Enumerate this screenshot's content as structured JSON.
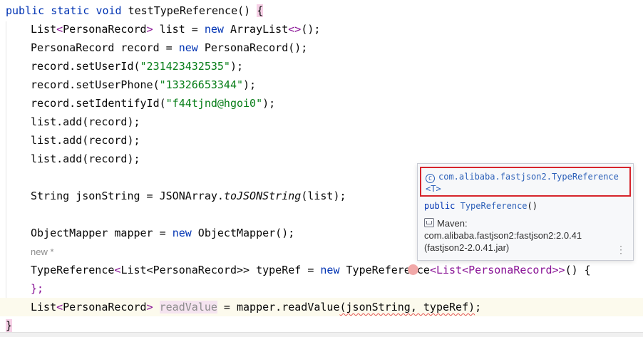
{
  "editor": {
    "line1": {
      "kw1": "public",
      "kw2": "static",
      "kw3": "void",
      "method": "testTypeReference",
      "paren": "()",
      "brace": "{"
    },
    "line2": {
      "t1": "List",
      "lt": "<",
      "gen": "PersonaRecord",
      "gt": ">",
      "rest": " list = ",
      "kw": "new",
      "rest2": " ArrayList",
      "gen2": "<>",
      "end": "();"
    },
    "line3": {
      "t1": "PersonaRecord record = ",
      "kw": "new",
      "rest": " PersonaRecord();"
    },
    "line4": {
      "pre": "record.setUserId(",
      "str": "\"231423432535\"",
      "post": ");"
    },
    "line5": {
      "pre": "record.setUserPhone(",
      "str": "\"13326653344\"",
      "post": ");"
    },
    "line6": {
      "pre": "record.setIdentifyId(",
      "str": "\"f44tjnd@hgoi0\"",
      "post": ");"
    },
    "line7": {
      "text": "list.add(record);"
    },
    "line8": {
      "text": "list.add(record);"
    },
    "line9": {
      "text": "list.add(record);"
    },
    "line11": {
      "pre": "String jsonString = JSONArray.",
      "ital": "toJSONString",
      "post": "(list);"
    },
    "line13": {
      "pre": "ObjectMapper mapper = ",
      "kw": "new",
      "post": " ObjectMapper();"
    },
    "hint": {
      "text": "new *"
    },
    "line15": {
      "t1": "TypeReference",
      "lt": "<",
      "gen": "List<PersonaRecord>>",
      "rest": " typeRef = ",
      "kw": "new",
      "rest2": " TypeReference",
      "gen2": "<List<PersonaRecord>>",
      "end": "() {"
    },
    "line16": {
      "text": "};"
    },
    "line17": {
      "t1": "List",
      "lt": "<",
      "gen": "PersonaRecord",
      "gt": ">",
      "unused": "readValue",
      "rest": " = mapper.readValue",
      "sq": "(jsonString, typeRef)",
      "end": ";"
    },
    "line18": {
      "brace": "}"
    }
  },
  "popup": {
    "class_icon": "C",
    "qualified_name": "com.alibaba.fastjson2.TypeReference",
    "type_param": "<T>",
    "signature_kw": "public",
    "signature_cls": "TypeReference",
    "signature_end": "()",
    "maven_label": "Maven:",
    "maven_coord": "com.alibaba.fastjson2:fastjson2:2.0.41",
    "maven_jar": "(fastjson2-2.0.41.jar)",
    "menu_glyph": "⋮"
  },
  "colors": {
    "keyword": "#0033b3",
    "string": "#067d17",
    "generic": "#871094",
    "highlight_border": "#d6242b",
    "link": "#2b5fb8"
  }
}
